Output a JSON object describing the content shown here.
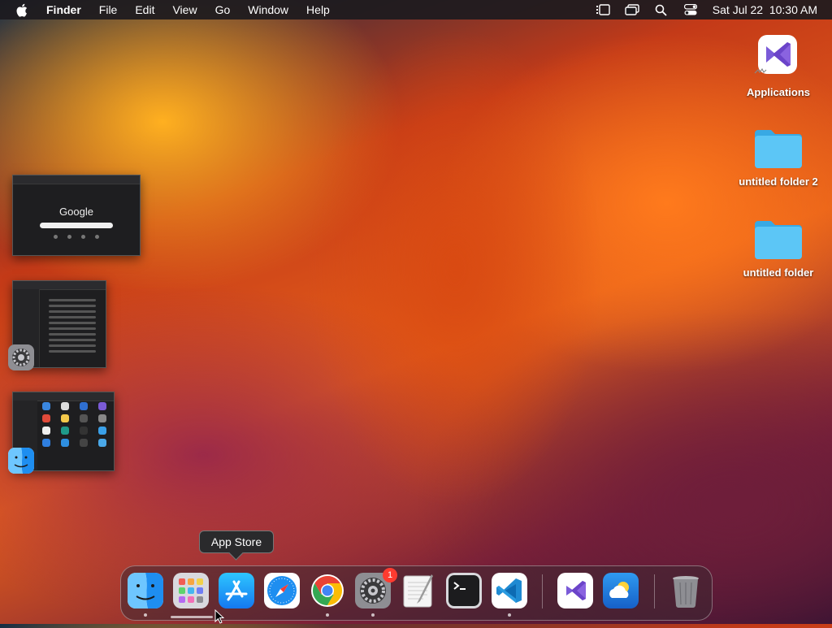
{
  "menubar": {
    "app_name": "Finder",
    "items": [
      "File",
      "Edit",
      "View",
      "Go",
      "Window",
      "Help"
    ],
    "datetime": "Sat Jul 22  10:30 AM"
  },
  "desktop": {
    "icons": [
      {
        "label": "Applications",
        "icon": "visual-studio-icon"
      },
      {
        "label": "untitled folder 2",
        "icon": "folder-icon"
      },
      {
        "label": "untitled folder",
        "icon": "folder-icon"
      }
    ]
  },
  "stage": {
    "google_thumb_text": "Google"
  },
  "tooltip": {
    "text": "App Store"
  },
  "dock": {
    "apps": [
      {
        "name": "Finder",
        "running": true
      },
      {
        "name": "Launchpad",
        "running": false
      },
      {
        "name": "App Store",
        "running": false
      },
      {
        "name": "Safari",
        "running": false
      },
      {
        "name": "Google Chrome",
        "running": true
      },
      {
        "name": "System Settings",
        "running": true,
        "badge": "1"
      },
      {
        "name": "TextEdit",
        "running": false
      },
      {
        "name": "Terminal",
        "running": false
      },
      {
        "name": "Visual Studio Code",
        "running": true
      },
      {
        "name": "Visual Studio",
        "running": false
      },
      {
        "name": "Weather",
        "running": false
      },
      {
        "name": "Trash",
        "running": false
      }
    ]
  },
  "colors": {
    "menubar": "#1c1a1e",
    "folder": "#4fc3f7",
    "badge": "#ff3b30"
  }
}
